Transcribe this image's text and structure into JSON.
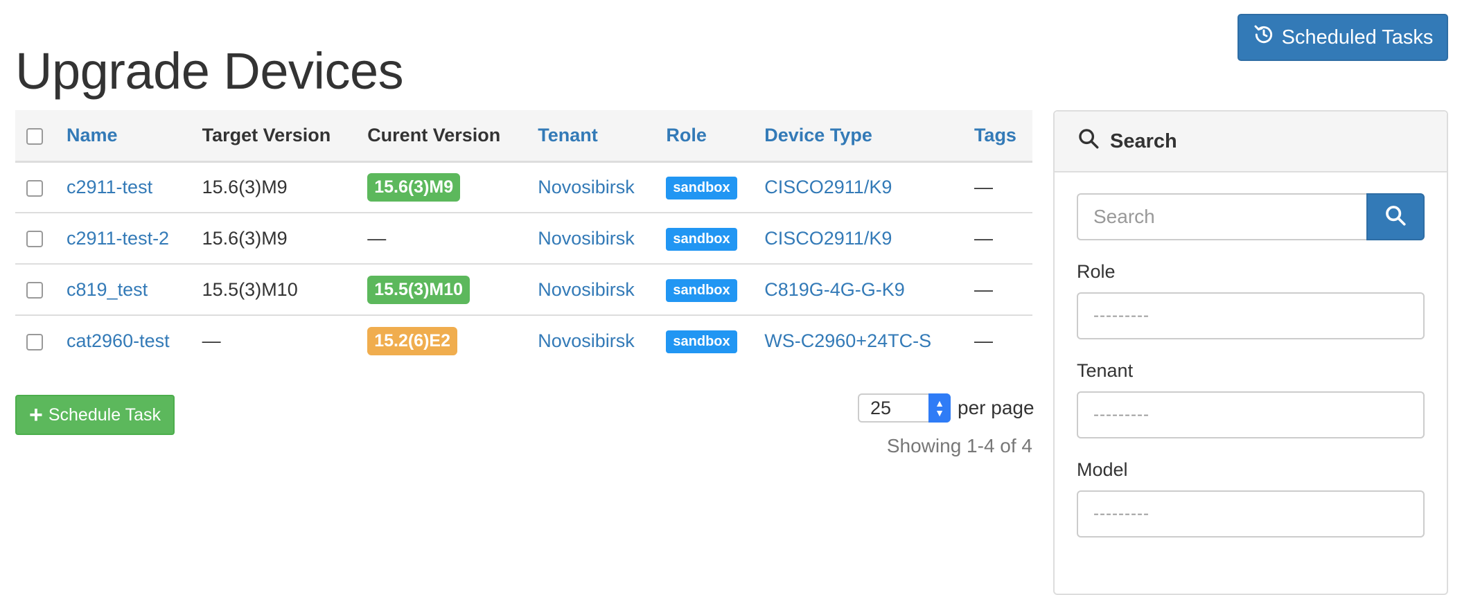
{
  "page": {
    "title": "Upgrade Devices"
  },
  "header": {
    "scheduled_tasks_label": "Scheduled Tasks"
  },
  "table": {
    "columns": [
      "Name",
      "Target Version",
      "Curent Version",
      "Tenant",
      "Role",
      "Device Type",
      "Tags"
    ],
    "rows": [
      {
        "name": "c2911-test",
        "target_version": "15.6(3)M9",
        "current_version": "15.6(3)M9",
        "current_status": "match",
        "tenant": "Novosibirsk",
        "role": "sandbox",
        "device_type": "CISCO2911/K9",
        "tags": "—"
      },
      {
        "name": "c2911-test-2",
        "target_version": "15.6(3)M9",
        "current_version": "—",
        "current_status": "none",
        "tenant": "Novosibirsk",
        "role": "sandbox",
        "device_type": "CISCO2911/K9",
        "tags": "—"
      },
      {
        "name": "c819_test",
        "target_version": "15.5(3)M10",
        "current_version": "15.5(3)M10",
        "current_status": "match",
        "tenant": "Novosibirsk",
        "role": "sandbox",
        "device_type": "C819G-4G-G-K9",
        "tags": "—"
      },
      {
        "name": "cat2960-test",
        "target_version": "—",
        "current_version": "15.2(6)E2",
        "current_status": "mismatch",
        "tenant": "Novosibirsk",
        "role": "sandbox",
        "device_type": "WS-C2960+24TC-S",
        "tags": "—"
      }
    ]
  },
  "actions": {
    "schedule_task_label": "Schedule Task"
  },
  "pagination": {
    "per_page_value": "25",
    "per_page_label": "per page",
    "showing": "Showing 1-4 of 4"
  },
  "search_panel": {
    "title": "Search",
    "search_placeholder": "Search",
    "fields": [
      {
        "label": "Role",
        "value": "---------"
      },
      {
        "label": "Tenant",
        "value": "---------"
      },
      {
        "label": "Model",
        "value": "---------"
      }
    ]
  },
  "colors": {
    "primary": "#337ab7",
    "success": "#5cb85c",
    "warning": "#f0ad4e",
    "role_badge": "#2196f3"
  }
}
